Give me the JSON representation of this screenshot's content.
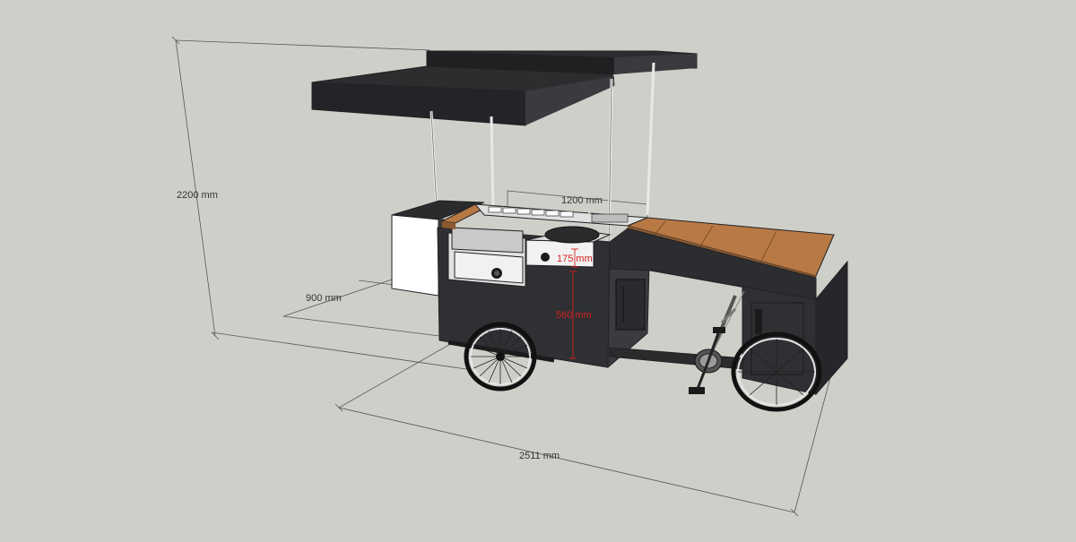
{
  "dimensions": {
    "height": "2200 mm",
    "depth": "900 mm",
    "length": "2511 mm",
    "counter_width": "1200 mm",
    "griddle_height": "175 mm",
    "counter_height": "560 mm"
  },
  "colors": {
    "background": "#cfcfca",
    "canopy": "#2c2d2f",
    "cabinet": "#2f3033",
    "wood": "#b87945",
    "steel": "#d9d9d9",
    "dimension_red": "#d42020"
  }
}
